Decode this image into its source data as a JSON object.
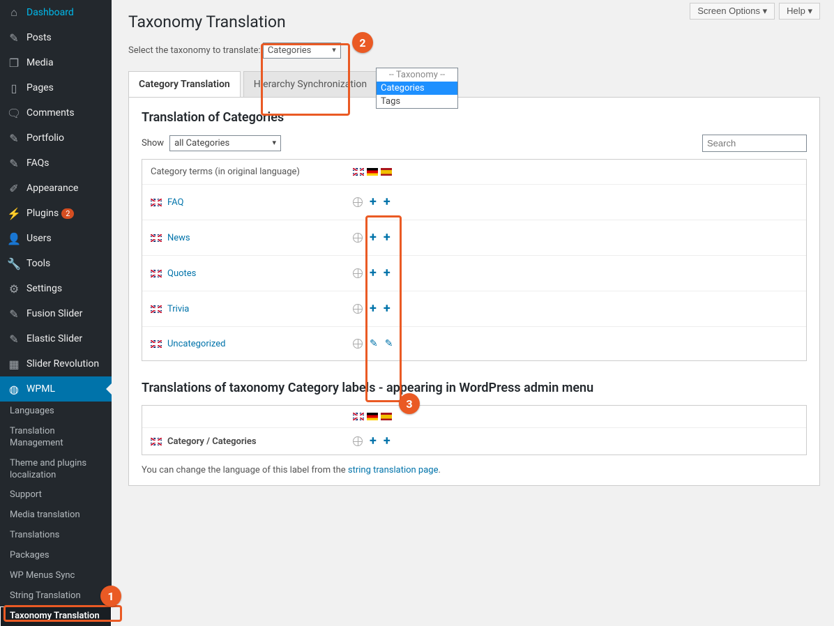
{
  "topbar": {
    "screen_options": "Screen Options ▾",
    "help": "Help ▾"
  },
  "sidebar": {
    "items": [
      {
        "icon": "🏠",
        "label": "Dashboard"
      },
      {
        "icon": "📌",
        "label": "Posts"
      },
      {
        "icon": "🖼",
        "label": "Media"
      },
      {
        "icon": "📄",
        "label": "Pages"
      },
      {
        "icon": "💬",
        "label": "Comments"
      },
      {
        "icon": "📌",
        "label": "Portfolio"
      },
      {
        "icon": "📌",
        "label": "FAQs"
      },
      {
        "icon": "🖌",
        "label": "Appearance"
      },
      {
        "icon": "🔌",
        "label": "Plugins",
        "badge": "2"
      },
      {
        "icon": "👤",
        "label": "Users"
      },
      {
        "icon": "🔧",
        "label": "Tools"
      },
      {
        "icon": "⚙",
        "label": "Settings"
      },
      {
        "icon": "📌",
        "label": "Fusion Slider"
      },
      {
        "icon": "📌",
        "label": "Elastic Slider"
      },
      {
        "icon": "▦",
        "label": "Slider Revolution"
      },
      {
        "icon": "🌐",
        "label": "WPML"
      }
    ],
    "subitems": [
      "Languages",
      "Translation Management",
      "Theme and plugins localization",
      "Support",
      "Media translation",
      "Translations",
      "Packages",
      "WP Menus Sync",
      "String Translation",
      "Taxonomy Translation"
    ]
  },
  "page": {
    "title": "Taxonomy Translation",
    "select_label": "Select the taxonomy to translate:",
    "select_value": "Categories",
    "dropdown": {
      "header": "-- Taxonomy --",
      "opt1": "Categories",
      "opt2": "Tags"
    },
    "tabs": [
      "Category Translation",
      "Hierarchy Synchronization"
    ],
    "section1": "Translation of Categories",
    "show_label": "Show",
    "show_value": "all Categories",
    "search_placeholder": "Search",
    "header_terms": "Category terms (in original language)",
    "rows": [
      {
        "name": "FAQ",
        "type": "plus"
      },
      {
        "name": "News",
        "type": "plus"
      },
      {
        "name": "Quotes",
        "type": "plus"
      },
      {
        "name": "Trivia",
        "type": "plus"
      },
      {
        "name": "Uncategorized",
        "type": "pencil"
      }
    ],
    "section2": "Translations of taxonomy Category labels - appearing in WordPress admin menu",
    "label_row": "Category / Categories",
    "footnote_pre": "You can change the language of this label from the ",
    "footnote_link": "string translation page",
    "footnote_post": "."
  },
  "annotations": {
    "b1": "1",
    "b2": "2",
    "b3": "3"
  }
}
